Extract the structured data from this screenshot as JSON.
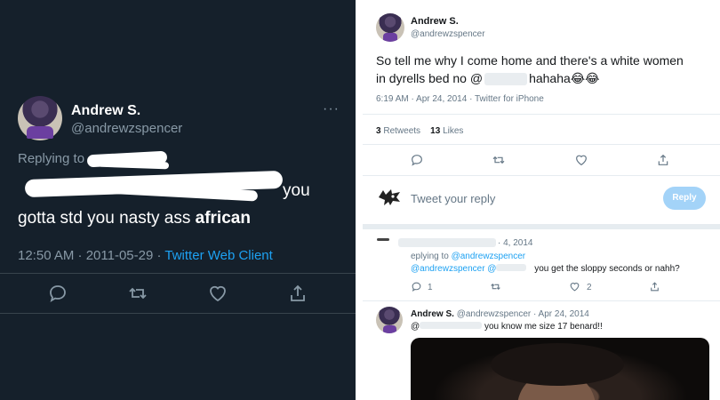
{
  "left": {
    "author_name": "Andrew S.",
    "author_handle": "@andrewzspencer",
    "more": "···",
    "replying_to": "Replying to",
    "tweet_tail": "you",
    "tweet_line2": "gotta std you nasty ass",
    "tweet_bold": "african",
    "timestamp": "12:50 AM · 2011-05-29 ·",
    "client": "Twitter Web Client"
  },
  "right": {
    "main": {
      "author_name": "Andrew S.",
      "author_handle": "@andrewzspencer",
      "text_line1": "So tell me why I come home and there's a white women",
      "text_line2_a": "in dyrells bed no @",
      "text_line2_b": "hahaha😂😂",
      "meta": "6:19 AM · Apr 24, 2014 · Twitter for iPhone",
      "retweets_count": "3",
      "retweets_label": "Retweets",
      "likes_count": "13",
      "likes_label": "Likes"
    },
    "compose": {
      "placeholder": "Tweet your reply",
      "reply_label": "Reply"
    },
    "reply1": {
      "date": "· 4, 2014",
      "replying_prefix": "eplying to",
      "replying_handle": "@andrewzspencer",
      "mention": "@andrewzspencer @",
      "text": "you get the sloppy seconds or nahh?",
      "reply_count": "1",
      "like_count": "2"
    },
    "reply2": {
      "author_name": "Andrew S.",
      "meta": "@andrewzspencer · Apr 24, 2014",
      "mention": "@",
      "text": "you know me size 17 benard!!"
    }
  },
  "colors": {
    "dark_bg": "#15202b",
    "dark_secondary": "#8899a6",
    "accent": "#1da1f2",
    "light_secondary": "#657786",
    "reply_button_disabled": "#a3d3f8"
  },
  "icons": [
    "reply-icon",
    "retweet-icon",
    "like-icon",
    "share-icon",
    "more-icon"
  ]
}
